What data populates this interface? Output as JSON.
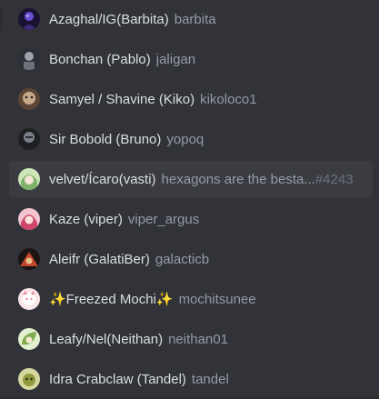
{
  "members": [
    {
      "display_name": "Azaghal/IG(Barbita)",
      "username": "barbita",
      "avatar_icon": "dark-purple-avatar-icon",
      "avatar_colors": [
        "#1a1030",
        "#6b4fd6"
      ]
    },
    {
      "display_name": "Bonchan (Pablo)",
      "username": "jaligan",
      "avatar_icon": "knight-avatar-icon",
      "avatar_colors": [
        "#2c2f36",
        "#9ca3ad"
      ]
    },
    {
      "display_name": "Samyel / Shavine (Kiko)",
      "username": "kikoloco1",
      "avatar_icon": "tan-creature-avatar-icon",
      "avatar_colors": [
        "#5b4636",
        "#c7a98a"
      ]
    },
    {
      "display_name": "Sir Bobold (Bruno)",
      "username": "yopoq",
      "avatar_icon": "armored-avatar-icon",
      "avatar_colors": [
        "#1e1f22",
        "#7a7f88"
      ]
    },
    {
      "display_name": "velvet/Ícaro(vasti)",
      "username": "hexagons are the besta...",
      "discriminator": "#4243",
      "avatar_icon": "green-anime-avatar-icon",
      "avatar_colors": [
        "#cfe6b8",
        "#7fb36a"
      ],
      "hovered": true
    },
    {
      "display_name": "Kaze (viper)",
      "username": "viper_argus",
      "avatar_icon": "pink-hair-avatar-icon",
      "avatar_colors": [
        "#f2c4cf",
        "#d0456c"
      ]
    },
    {
      "display_name": "Aleifr (GalatiBer)",
      "username": "galacticb",
      "avatar_icon": "red-dark-avatar-icon",
      "avatar_colors": [
        "#1b1412",
        "#c2452f"
      ]
    },
    {
      "display_name": "✨Freezed Mochi✨",
      "username": "mochitsunee",
      "avatar_icon": "cute-pink-avatar-icon",
      "avatar_colors": [
        "#fbe7ea",
        "#e88a9d"
      ]
    },
    {
      "display_name": "Leafy/Nel(Neithan)",
      "username": "neithan01",
      "avatar_icon": "leaf-avatar-icon",
      "avatar_colors": [
        "#e3f0cf",
        "#7da94f"
      ]
    },
    {
      "display_name": "Idra Crabclaw (Tandel)",
      "username": "tandel",
      "avatar_icon": "olive-creature-avatar-icon",
      "avatar_colors": [
        "#d7d7a0",
        "#8f9b3e"
      ]
    }
  ]
}
